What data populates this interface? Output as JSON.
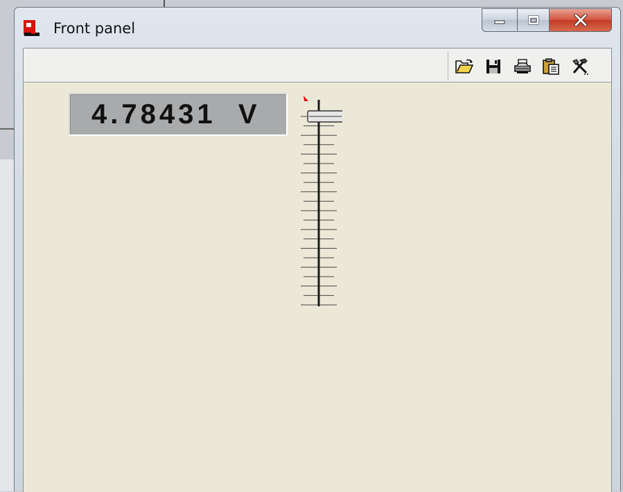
{
  "window": {
    "title": "Front panel",
    "caption_buttons": {
      "minimize": "minimize-icon",
      "maximize": "maximize-icon",
      "close": "close-icon"
    }
  },
  "toolbar": {
    "items": [
      {
        "name": "open-folder-icon",
        "action": "open"
      },
      {
        "name": "save-disk-icon",
        "action": "save"
      },
      {
        "name": "printer-icon",
        "action": "print"
      },
      {
        "name": "clipboard-icon",
        "action": "paste"
      },
      {
        "name": "tools-icon",
        "action": "tools"
      }
    ]
  },
  "display": {
    "value": "4.78431",
    "unit": "V"
  },
  "slider": {
    "level": 1.0,
    "tick_count": 21,
    "marker_color": "#e01010"
  },
  "colors": {
    "panel_bg": "#ebe8d8",
    "display_bg": "#a9aaac",
    "close_red": "#c8432c"
  }
}
